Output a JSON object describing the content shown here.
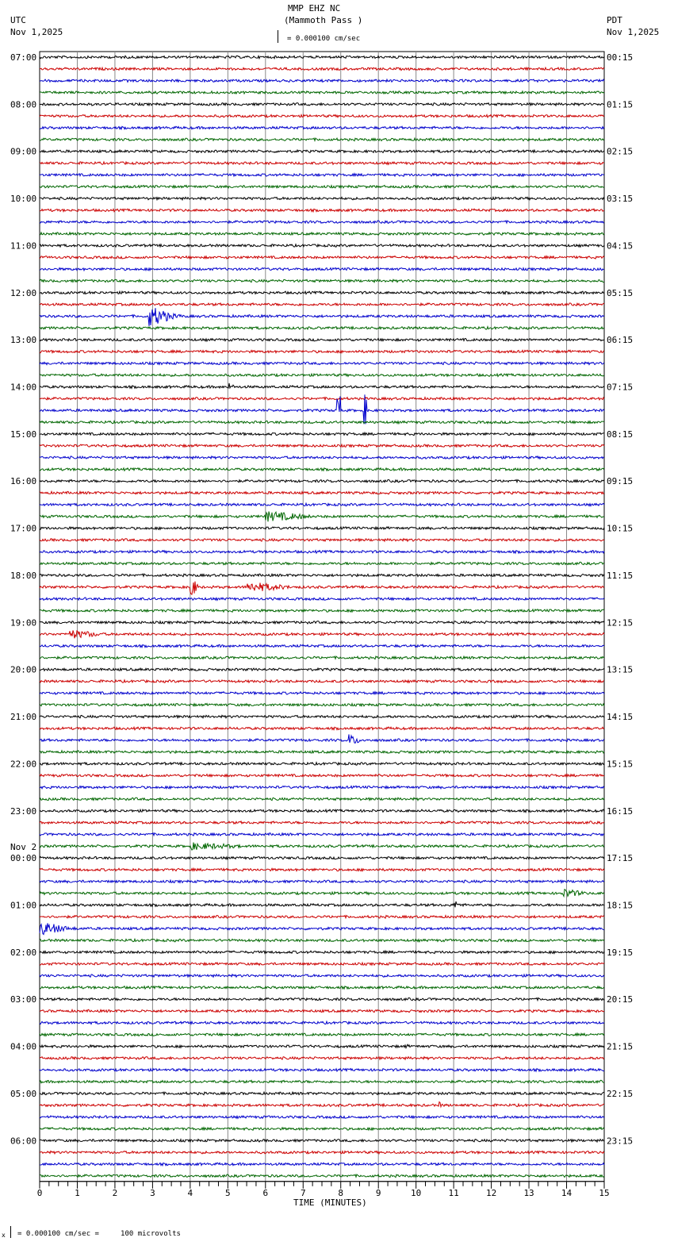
{
  "header": {
    "title": "MMP EHZ NC",
    "subtitle": "(Mammoth Pass )",
    "scale": "= 0.000100 cm/sec",
    "left_tz": "UTC",
    "left_date": "Nov 1,2025",
    "right_tz": "PDT",
    "right_date": "Nov 1,2025"
  },
  "footer": {
    "scale": "= 0.000100 cm/sec =     100 microvolts",
    "prefix": "x"
  },
  "chart_data": {
    "type": "line",
    "title": "MMP EHZ NC (Mammoth Pass )",
    "xlabel": "TIME (MINUTES)",
    "xlim": [
      0,
      15
    ],
    "x_ticks": [
      "0",
      "1",
      "2",
      "3",
      "4",
      "5",
      "6",
      "7",
      "8",
      "9",
      "10",
      "11",
      "12",
      "13",
      "14",
      "15"
    ],
    "trace_colors": [
      "#000000",
      "#cc0000",
      "#0000cc",
      "#006600"
    ],
    "traces_per_hour": 4,
    "left_labels": [
      "07:00",
      "08:00",
      "09:00",
      "10:00",
      "11:00",
      "12:00",
      "13:00",
      "14:00",
      "15:00",
      "16:00",
      "17:00",
      "18:00",
      "19:00",
      "20:00",
      "21:00",
      "22:00",
      "23:00",
      "00:00",
      "01:00",
      "02:00",
      "03:00",
      "04:00",
      "05:00",
      "06:00"
    ],
    "date_change_label": "Nov 2",
    "right_labels": [
      "00:15",
      "01:15",
      "02:15",
      "03:15",
      "04:15",
      "05:15",
      "06:15",
      "07:15",
      "08:15",
      "09:15",
      "10:15",
      "11:15",
      "12:15",
      "13:15",
      "14:15",
      "15:15",
      "16:15",
      "17:15",
      "18:15",
      "19:15",
      "20:15",
      "21:15",
      "22:15",
      "23:15"
    ],
    "events": [
      {
        "trace": 22,
        "minute": 2.9,
        "duration": 0.8,
        "amp": 14
      },
      {
        "trace": 28,
        "minute": 5.0,
        "duration": 0.2,
        "amp": 6
      },
      {
        "trace": 30,
        "minute": 7.9,
        "duration": 0.05,
        "amp": 18
      },
      {
        "trace": 30,
        "minute": 8.6,
        "duration": 0.05,
        "amp": 20
      },
      {
        "trace": 39,
        "minute": 6.0,
        "duration": 1.6,
        "amp": 7
      },
      {
        "trace": 45,
        "minute": 4.0,
        "duration": 0.2,
        "amp": 16
      },
      {
        "trace": 45,
        "minute": 5.5,
        "duration": 1.5,
        "amp": 7
      },
      {
        "trace": 49,
        "minute": 0.8,
        "duration": 1.2,
        "amp": 6
      },
      {
        "trace": 58,
        "minute": 8.2,
        "duration": 0.4,
        "amp": 8
      },
      {
        "trace": 67,
        "minute": 4.0,
        "duration": 2.0,
        "amp": 5
      },
      {
        "trace": 71,
        "minute": 13.9,
        "duration": 0.8,
        "amp": 6
      },
      {
        "trace": 74,
        "minute": 0.0,
        "duration": 1.0,
        "amp": 9
      },
      {
        "trace": 72,
        "minute": 11.0,
        "duration": 0.3,
        "amp": 6
      },
      {
        "trace": 84,
        "minute": 9.7,
        "duration": 0.1,
        "amp": 5
      },
      {
        "trace": 89,
        "minute": 10.6,
        "duration": 0.1,
        "amp": 5
      }
    ]
  }
}
